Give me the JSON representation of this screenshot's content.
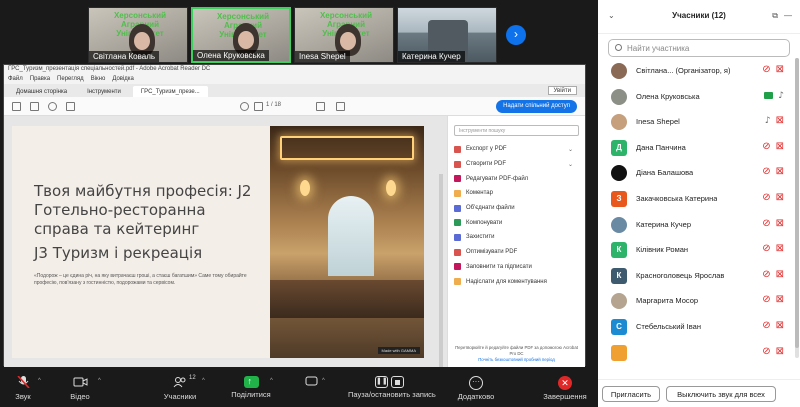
{
  "gallery": [
    {
      "name": "Світлана Коваль",
      "active": false,
      "overlay": "Херсонський Аграрний Університет"
    },
    {
      "name": "Олена Круковська",
      "active": true,
      "overlay": "Херсонський Аграрний Університет"
    },
    {
      "name": "Inesa Shepel",
      "active": false,
      "overlay": "Херсонський Аграрний Університет"
    },
    {
      "name": "Катерина Кучер",
      "active": false,
      "overlay": ""
    }
  ],
  "gallery_next": "›",
  "acrobat": {
    "title": "ГРС_Туризм_презентація спеціальностей.pdf - Adobe Acrobat Reader DC",
    "menu": [
      "Файл",
      "Правка",
      "Перегляд",
      "Вікно",
      "Довідка"
    ],
    "tabs": [
      "Домашня сторінка",
      "Інструменти",
      "ГРС_Туризм_презе..."
    ],
    "enter": "Увійти",
    "pager": "1  /  18",
    "share_btn": "Надати спільний доступ",
    "slide": {
      "title": "Твоя майбутня професія: J2 Готельно-ресторанна справа та кейтеринг",
      "subtitle": "J3 Туризм і рекреація",
      "text": "«Подорож – це єдина річ, на яку витрачаєш гроші, а стаєш багатшим» Саме тому обирайте професію, пов'язану з гостинністю, подорожами та сервісом.",
      "made_with": "Made with GAMMA"
    },
    "tools_search": "Інструменти пошуку",
    "tools": [
      {
        "label": "Експорт у PDF",
        "color": "#d9534f",
        "chev": "⌄"
      },
      {
        "label": "Створити PDF",
        "color": "#d9534f",
        "chev": "⌄"
      },
      {
        "label": "Редагувати PDF-файл",
        "color": "#c2185b",
        "chev": ""
      },
      {
        "label": "Коментар",
        "color": "#f0ad4e",
        "chev": ""
      },
      {
        "label": "Об'єднати файли",
        "color": "#5b6bd6",
        "chev": ""
      },
      {
        "label": "Компонувати",
        "color": "#2e9a5a",
        "chev": ""
      },
      {
        "label": "Захистити",
        "color": "#5b6bd6",
        "chev": ""
      },
      {
        "label": "Оптимізувати PDF",
        "color": "#d9534f",
        "chev": ""
      },
      {
        "label": "Заповнити та підписати",
        "color": "#c2185b",
        "chev": ""
      },
      {
        "label": "Надіслати для коментування",
        "color": "#f0ad4e",
        "chev": ""
      }
    ],
    "tools_foot": "Перетворюйте й редагуйте файли PDF за допомогою Acrobat Pro DC",
    "tools_link": "Почніть безкоштовний пробний період"
  },
  "toolbar": {
    "audio": "Звук",
    "video": "Відео",
    "participants": "Учасники",
    "participants_count": "12",
    "share": "Поділитися",
    "record": "Пауза/остановить запись",
    "more": "Додатково",
    "end": "Завершення"
  },
  "panel": {
    "title": "Учасники (12)",
    "search_placeholder": "Найти участника",
    "invite": "Пригласить",
    "mute_all": "Выключить звук для всех",
    "participants": [
      {
        "name": "Світлана... (Організатор, я)",
        "avatar": "photo",
        "color": "#8a6a55",
        "initial": "",
        "mic": "off",
        "cam": "off"
      },
      {
        "name": "Олена Круковська",
        "avatar": "photo",
        "color": "#8b8f85",
        "initial": "",
        "mic": "on",
        "cam": "on"
      },
      {
        "name": "Inesa Shepel",
        "avatar": "photo",
        "color": "#c69f7c",
        "initial": "",
        "mic": "on",
        "cam": "off"
      },
      {
        "name": "Дана Панчина",
        "avatar": "letter",
        "color": "#2db36a",
        "initial": "Д",
        "mic": "off",
        "cam": "off"
      },
      {
        "name": "Діана Балашова",
        "avatar": "photo",
        "color": "#111111",
        "initial": "",
        "mic": "off",
        "cam": "off"
      },
      {
        "name": "Закачковська Катерина",
        "avatar": "letter",
        "color": "#e8571b",
        "initial": "З",
        "mic": "off",
        "cam": "off"
      },
      {
        "name": "Катерина Кучер",
        "avatar": "photo",
        "color": "#6a8aa3",
        "initial": "",
        "mic": "off",
        "cam": "off"
      },
      {
        "name": "Кілівник Роман",
        "avatar": "letter",
        "color": "#2db36a",
        "initial": "К",
        "mic": "off",
        "cam": "off"
      },
      {
        "name": "Красноголовець Ярослав",
        "avatar": "letter",
        "color": "#3e5a6e",
        "initial": "К",
        "mic": "off",
        "cam": "off"
      },
      {
        "name": "Маргарита Мосор",
        "avatar": "photo",
        "color": "#b5a48f",
        "initial": "",
        "mic": "off",
        "cam": "off"
      },
      {
        "name": "Стебельський Іван",
        "avatar": "letter",
        "color": "#1d8bd1",
        "initial": "С",
        "mic": "off",
        "cam": "off"
      },
      {
        "name": "",
        "avatar": "letter",
        "color": "#f0a030",
        "initial": "",
        "mic": "off",
        "cam": "off"
      }
    ]
  }
}
